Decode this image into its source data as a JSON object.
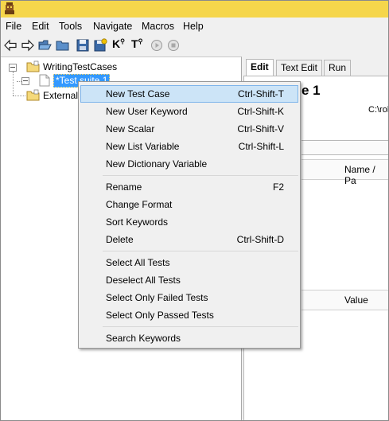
{
  "menubar": {
    "items": [
      "File",
      "Edit",
      "Tools",
      "Navigate",
      "Macros",
      "Help"
    ]
  },
  "toolbar": {
    "k_label": "K",
    "t_label": "T",
    "icons": [
      "back-arrow-icon",
      "forward-arrow-icon",
      "open-directory-icon",
      "open-folder-icon",
      "save-icon",
      "save-all-icon",
      "search-keywords-icon",
      "search-tests-icon",
      "run-icon",
      "stop-icon"
    ]
  },
  "tree": {
    "project": "WritingTestCases",
    "suite": "*Test suite 1",
    "external": "External R"
  },
  "editor": {
    "tabs": [
      "Edit",
      "Text Edit",
      "Run"
    ],
    "title_fragment": "e 1",
    "path_fragment": "C:\\rol",
    "col1_header": "Name / Pa",
    "col2_header": "Value"
  },
  "context_menu": {
    "items": [
      {
        "label": "New Test Case",
        "shortcut": "Ctrl-Shift-T"
      },
      {
        "label": "New User Keyword",
        "shortcut": "Ctrl-Shift-K"
      },
      {
        "label": "New Scalar",
        "shortcut": "Ctrl-Shift-V"
      },
      {
        "label": "New List Variable",
        "shortcut": "Ctrl-Shift-L"
      },
      {
        "label": "New Dictionary Variable",
        "shortcut": ""
      },
      {
        "label": "Rename",
        "shortcut": "F2"
      },
      {
        "label": "Change Format",
        "shortcut": ""
      },
      {
        "label": "Sort Keywords",
        "shortcut": ""
      },
      {
        "label": "Delete",
        "shortcut": "Ctrl-Shift-D"
      },
      {
        "label": "Select All Tests",
        "shortcut": ""
      },
      {
        "label": "Deselect All Tests",
        "shortcut": ""
      },
      {
        "label": "Select Only Failed Tests",
        "shortcut": ""
      },
      {
        "label": "Select Only Passed Tests",
        "shortcut": ""
      },
      {
        "label": "Search Keywords",
        "shortcut": ""
      }
    ]
  },
  "colors": {
    "titlebar": "#f5d64b",
    "highlight": "#cce4f7",
    "selection": "#3399ff"
  }
}
